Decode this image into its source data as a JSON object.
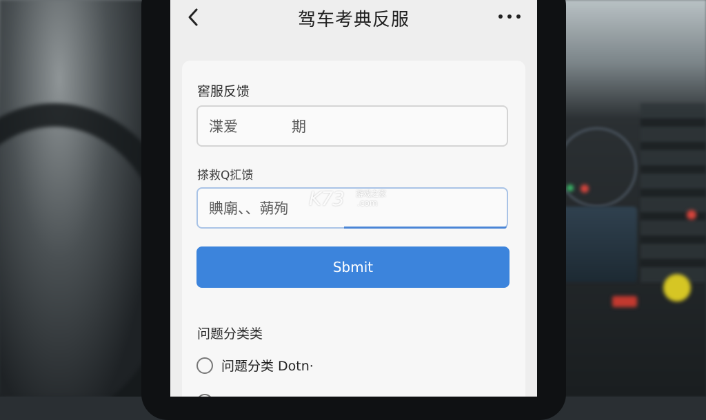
{
  "header": {
    "title": "驾车考典反服"
  },
  "form": {
    "section_label": "窖服反馈",
    "field1": {
      "value_part1": "渫爱",
      "value_part2": "期"
    },
    "field2_label": "搽救Q㧟馈",
    "field2": {
      "value": "賟廟、、蒴殉"
    },
    "submit_label": "Sbmit"
  },
  "category": {
    "heading": "问题分类类",
    "options": [
      {
        "label": "问题分类 Dotn·"
      }
    ]
  },
  "watermark": {
    "logo": "K73",
    "cn": "游戏之家",
    "com": ".com"
  },
  "colors": {
    "accent": "#3c84dc",
    "screen_bg": "#eeeeee",
    "card_bg": "#f7f7f7"
  }
}
